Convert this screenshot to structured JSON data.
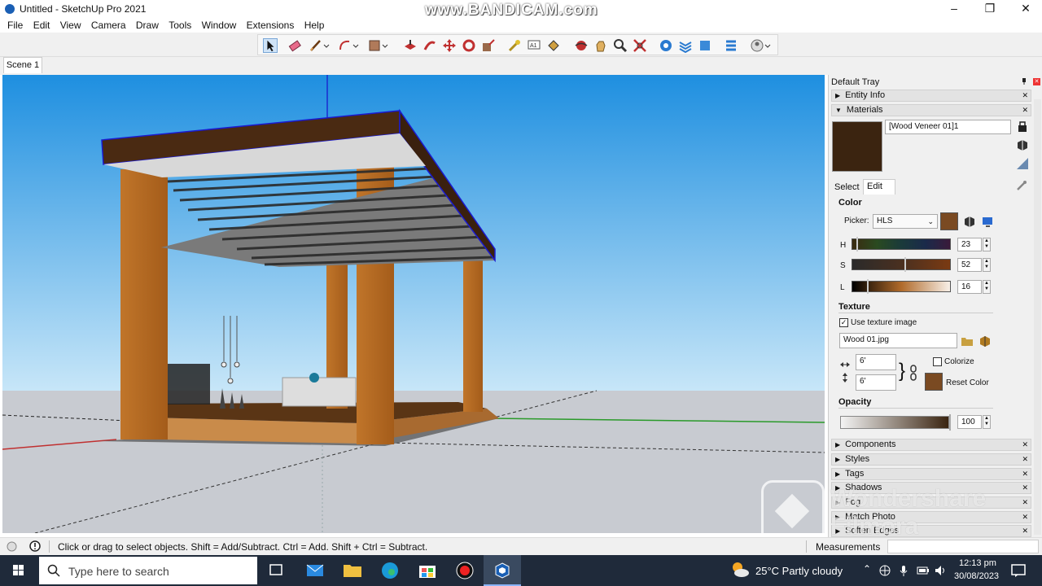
{
  "window": {
    "title": "Untitled - SketchUp Pro 2021",
    "watermark": "www.BANDICAM.com"
  },
  "menu": [
    "File",
    "Edit",
    "View",
    "Camera",
    "Draw",
    "Tools",
    "Window",
    "Extensions",
    "Help"
  ],
  "scene_tab": "Scene 1",
  "tray": {
    "title": "Default Tray",
    "panels_top": [
      {
        "label": "Entity Info"
      },
      {
        "label": "Materials"
      }
    ],
    "materials": {
      "name": "[Wood Veneer 01]1",
      "swatch_color": "#3b2410",
      "tabs": [
        "Select",
        "Edit"
      ],
      "color_heading": "Color",
      "picker_label": "Picker:",
      "picker_value": "HLS",
      "picker_swatch": "#7a4a22",
      "h_label": "H",
      "h_value": "23",
      "s_label": "S",
      "s_value": "52",
      "l_label": "L",
      "l_value": "16",
      "texture_heading": "Texture",
      "use_texture_label": "Use texture image",
      "texture_file": "Wood 01.jpg",
      "width_value": "6'",
      "height_value": "6'",
      "colorize_label": "Colorize",
      "reset_color_label": "Reset Color",
      "opacity_heading": "Opacity",
      "opacity_value": "100"
    },
    "panels_bottom": [
      {
        "label": "Components"
      },
      {
        "label": "Styles"
      },
      {
        "label": "Tags"
      },
      {
        "label": "Shadows"
      },
      {
        "label": "Fog"
      },
      {
        "label": "Match Photo"
      },
      {
        "label": "Soften Edges"
      }
    ]
  },
  "overlay_watermark": {
    "line1": "Wondershare",
    "line2": "Filmora"
  },
  "status": {
    "hint": "Click or drag to select objects. Shift = Add/Subtract. Ctrl = Add. Shift + Ctrl = Subtract.",
    "measurements_label": "Measurements"
  },
  "taskbar": {
    "search_placeholder": "Type here to search",
    "weather": "25°C  Partly cloudy",
    "time": "12:13 pm",
    "date": "30/08/2023"
  },
  "colors": {
    "sky_top": "#1e8fe0",
    "sky_bottom": "#bfe0f7",
    "ground": "#c8cbd1",
    "wood": "#b8691f",
    "roof": "#4a2a12"
  }
}
